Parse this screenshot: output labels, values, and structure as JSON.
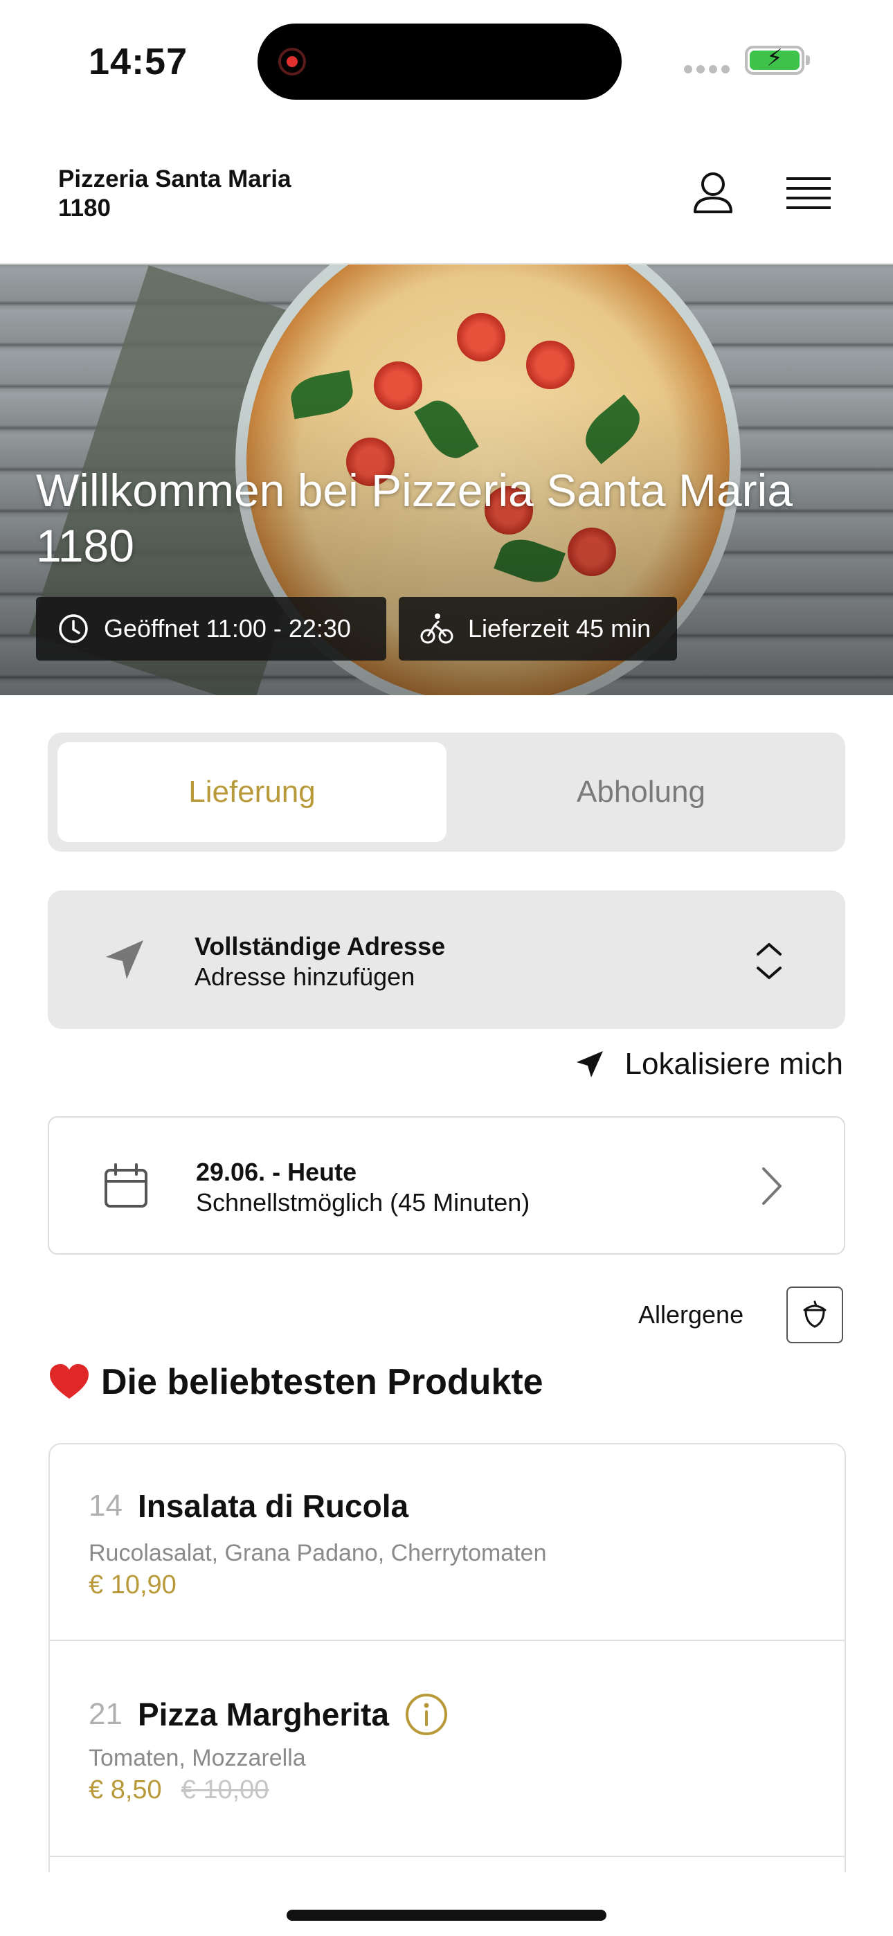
{
  "status_bar": {
    "time": "14:57"
  },
  "header": {
    "brand_line1": "Pizzeria Santa Maria",
    "brand_line2": "1180"
  },
  "hero": {
    "title": "Willkommen bei Pizzeria Santa Maria 1180",
    "opening_hours": "Geöffnet 11:00 - 22:30",
    "delivery_time": "Lieferzeit 45 min"
  },
  "tabs": [
    {
      "label": "Lieferung",
      "active": true
    },
    {
      "label": "Abholung",
      "active": false
    }
  ],
  "address": {
    "title": "Vollständige Adresse",
    "subtitle": "Adresse hinzufügen"
  },
  "locate": {
    "label": "Lokalisiere mich"
  },
  "date": {
    "title": "29.06. - Heute",
    "subtitle": "Schnellstmöglich (45 Minuten)"
  },
  "allergens": {
    "label": "Allergene"
  },
  "section": {
    "title": "Die beliebtesten Produkte"
  },
  "products": [
    {
      "number": "14",
      "name": "Insalata di Rucola",
      "description": "Rucolasalat, Grana Padano, Cherrytomaten",
      "price": "€ 10,90",
      "old_price": ""
    },
    {
      "number": "21",
      "name": "Pizza Margherita",
      "description": "Tomaten, Mozzarella",
      "price": "€ 8,50",
      "old_price": "€ 10,00"
    }
  ],
  "colors": {
    "accent": "#b99a3a",
    "panel": "#e8e8e8",
    "chip": "#141414"
  }
}
